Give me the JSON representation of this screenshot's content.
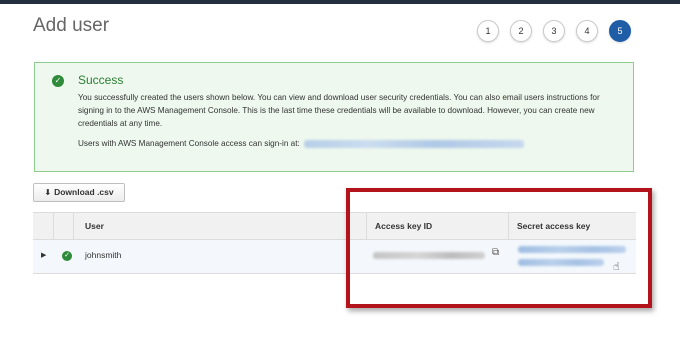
{
  "page": {
    "title": "Add user"
  },
  "steps": [
    {
      "label": "1",
      "active": false
    },
    {
      "label": "2",
      "active": false
    },
    {
      "label": "3",
      "active": false
    },
    {
      "label": "4",
      "active": false
    },
    {
      "label": "5",
      "active": true
    }
  ],
  "success": {
    "title": "Success",
    "message": "You successfully created the users shown below. You can view and download user security credentials. You can also email users instructions for signing in to the AWS Management Console. This is the last time these credentials will be available to download. However, you can create new credentials at any time.",
    "signin_label": "Users with AWS Management Console access can sign-in at:"
  },
  "toolbar": {
    "download_label": "Download .csv"
  },
  "table": {
    "headers": {
      "user": "User",
      "access_key_id": "Access key ID",
      "secret_access_key": "Secret access key"
    },
    "rows": [
      {
        "user": "johnsmith"
      }
    ]
  },
  "icons": {
    "success": "check-circle-icon",
    "download": "download-icon",
    "expand": "caret-right-icon",
    "copy": "copy-icon",
    "cursor": "hand-pointer-icon"
  },
  "colors": {
    "active_step": "#1f5da6",
    "success_green": "#2a7f33",
    "success_bg": "#eef8ee",
    "highlight_red": "#b3141b"
  }
}
